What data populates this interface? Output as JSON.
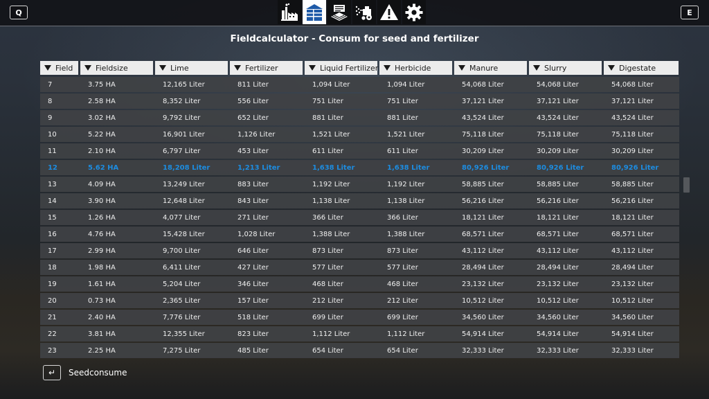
{
  "topbar": {
    "prev_key": "Q",
    "next_key": "E",
    "tabs": [
      {
        "icon": "factory-icon",
        "active": false
      },
      {
        "icon": "silo-icon",
        "active": true
      },
      {
        "icon": "field-seed-icon",
        "active": false
      },
      {
        "icon": "sprayer-tractor-icon",
        "active": false
      },
      {
        "icon": "warning-icon",
        "active": false
      },
      {
        "icon": "gear-icon",
        "active": false
      }
    ]
  },
  "title": "Fieldcalculator - Consum for seed and fertilizer",
  "table": {
    "columns": [
      "Field",
      "Fieldsize",
      "Lime",
      "Fertilizer",
      "Liquid Fertilizer",
      "Herbicide",
      "Manure",
      "Slurry",
      "Digestate"
    ],
    "selected_row": 5,
    "rows": [
      [
        "7",
        "3.75 HA",
        "12,165 Liter",
        "811 Liter",
        "1,094 Liter",
        "1,094 Liter",
        "54,068 Liter",
        "54,068 Liter",
        "54,068 Liter"
      ],
      [
        "8",
        "2.58 HA",
        "8,352 Liter",
        "556 Liter",
        "751 Liter",
        "751 Liter",
        "37,121 Liter",
        "37,121 Liter",
        "37,121 Liter"
      ],
      [
        "9",
        "3.02 HA",
        "9,792 Liter",
        "652 Liter",
        "881 Liter",
        "881 Liter",
        "43,524 Liter",
        "43,524 Liter",
        "43,524 Liter"
      ],
      [
        "10",
        "5.22 HA",
        "16,901 Liter",
        "1,126 Liter",
        "1,521 Liter",
        "1,521 Liter",
        "75,118 Liter",
        "75,118 Liter",
        "75,118 Liter"
      ],
      [
        "11",
        "2.10 HA",
        "6,797 Liter",
        "453 Liter",
        "611 Liter",
        "611 Liter",
        "30,209 Liter",
        "30,209 Liter",
        "30,209 Liter"
      ],
      [
        "12",
        "5.62 HA",
        "18,208 Liter",
        "1,213 Liter",
        "1,638 Liter",
        "1,638 Liter",
        "80,926 Liter",
        "80,926 Liter",
        "80,926 Liter"
      ],
      [
        "13",
        "4.09 HA",
        "13,249 Liter",
        "883 Liter",
        "1,192 Liter",
        "1,192 Liter",
        "58,885 Liter",
        "58,885 Liter",
        "58,885 Liter"
      ],
      [
        "14",
        "3.90 HA",
        "12,648 Liter",
        "843 Liter",
        "1,138 Liter",
        "1,138 Liter",
        "56,216 Liter",
        "56,216 Liter",
        "56,216 Liter"
      ],
      [
        "15",
        "1.26 HA",
        "4,077 Liter",
        "271 Liter",
        "366 Liter",
        "366 Liter",
        "18,121 Liter",
        "18,121 Liter",
        "18,121 Liter"
      ],
      [
        "16",
        "4.76 HA",
        "15,428 Liter",
        "1,028 Liter",
        "1,388 Liter",
        "1,388 Liter",
        "68,571 Liter",
        "68,571 Liter",
        "68,571 Liter"
      ],
      [
        "17",
        "2.99 HA",
        "9,700 Liter",
        "646 Liter",
        "873 Liter",
        "873 Liter",
        "43,112 Liter",
        "43,112 Liter",
        "43,112 Liter"
      ],
      [
        "18",
        "1.98 HA",
        "6,411 Liter",
        "427 Liter",
        "577 Liter",
        "577 Liter",
        "28,494 Liter",
        "28,494 Liter",
        "28,494 Liter"
      ],
      [
        "19",
        "1.61 HA",
        "5,204 Liter",
        "346 Liter",
        "468 Liter",
        "468 Liter",
        "23,132 Liter",
        "23,132 Liter",
        "23,132 Liter"
      ],
      [
        "20",
        "0.73 HA",
        "2,365 Liter",
        "157 Liter",
        "212 Liter",
        "212 Liter",
        "10,512 Liter",
        "10,512 Liter",
        "10,512 Liter"
      ],
      [
        "21",
        "2.40 HA",
        "7,776 Liter",
        "518 Liter",
        "699 Liter",
        "699 Liter",
        "34,560 Liter",
        "34,560 Liter",
        "34,560 Liter"
      ],
      [
        "22",
        "3.81 HA",
        "12,355 Liter",
        "823 Liter",
        "1,112 Liter",
        "1,112 Liter",
        "54,914 Liter",
        "54,914 Liter",
        "54,914 Liter"
      ],
      [
        "23",
        "2.25 HA",
        "7,275 Liter",
        "485 Liter",
        "654 Liter",
        "654 Liter",
        "32,333 Liter",
        "32,333 Liter",
        "32,333 Liter"
      ]
    ]
  },
  "footer": {
    "key_icon": "enter-key-icon",
    "label": "Seedconsume"
  },
  "colors": {
    "selected_text": "#1d8ce0",
    "row_background": "#404245",
    "header_background": "#ececec",
    "tab_icon": "#1e5aa8"
  }
}
